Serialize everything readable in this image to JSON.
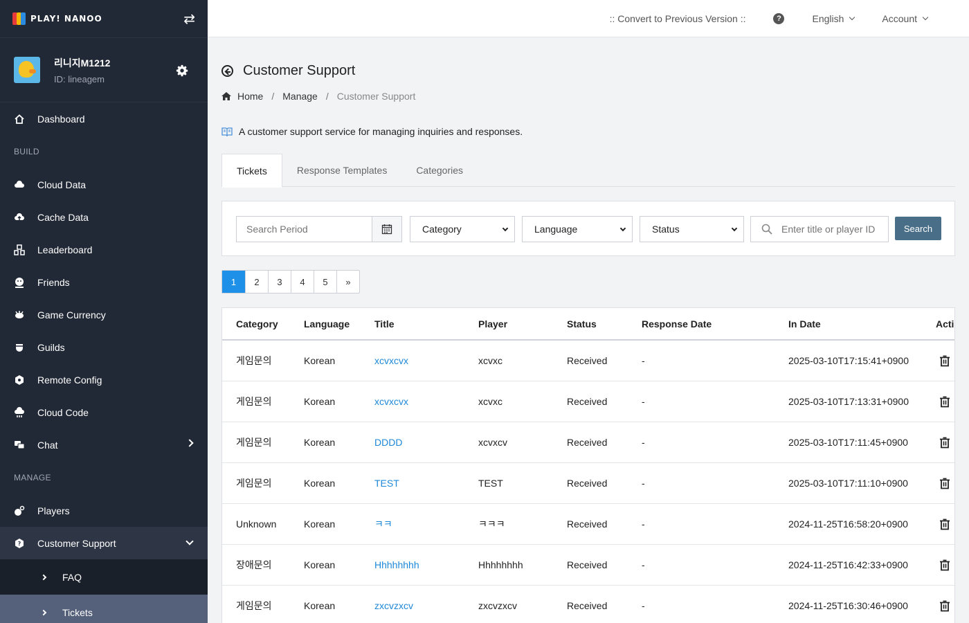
{
  "sidebar": {
    "logo_text": "PLAY! NANOO",
    "profile": {
      "name": "리니지M1212",
      "id": "ID: lineagem"
    },
    "dashboard": "Dashboard",
    "build_section": "BUILD",
    "build_items": [
      {
        "label": "Cloud Data",
        "icon": "cloud-icon"
      },
      {
        "label": "Cache Data",
        "icon": "cloud-upload-icon"
      },
      {
        "label": "Leaderboard",
        "icon": "leaderboard-icon"
      },
      {
        "label": "Friends",
        "icon": "friends-icon"
      },
      {
        "label": "Game Currency",
        "icon": "currency-icon"
      },
      {
        "label": "Guilds",
        "icon": "guilds-icon"
      },
      {
        "label": "Remote Config",
        "icon": "remote-config-icon"
      },
      {
        "label": "Cloud Code",
        "icon": "cloud-code-icon"
      },
      {
        "label": "Chat",
        "icon": "chat-icon"
      }
    ],
    "manage_section": "MANAGE",
    "players": "Players",
    "customer_support": "Customer Support",
    "sub_items": [
      "FAQ",
      "Tickets"
    ]
  },
  "topbar": {
    "convert": ":: Convert to Previous Version ::",
    "help": "?",
    "language": "English",
    "account": "Account"
  },
  "page": {
    "title": "Customer Support",
    "breadcrumb": [
      "Home",
      "Manage",
      "Customer Support"
    ],
    "breadcrumb_sep": "/",
    "description": "A customer support service for managing inquiries and responses."
  },
  "tabs": [
    "Tickets",
    "Response Templates",
    "Categories"
  ],
  "filters": {
    "period_placeholder": "Search Period",
    "category": "Category",
    "language": "Language",
    "status": "Status",
    "search_placeholder": "Enter title or player ID",
    "search_button": "Search"
  },
  "pagination": [
    "1",
    "2",
    "3",
    "4",
    "5",
    "»"
  ],
  "table": {
    "headers": [
      "Category",
      "Language",
      "Title",
      "Player",
      "Status",
      "Response Date",
      "In Date",
      "Action"
    ],
    "rows": [
      [
        "게임문의",
        "Korean",
        "xcvxcvx",
        "xcvxc",
        "Received",
        "-",
        "2025-03-10T17:15:41+0900"
      ],
      [
        "게임문의",
        "Korean",
        "xcvxcvx",
        "xcvxc",
        "Received",
        "-",
        "2025-03-10T17:13:31+0900"
      ],
      [
        "게임문의",
        "Korean",
        "DDDD",
        "xcvxcv",
        "Received",
        "-",
        "2025-03-10T17:11:45+0900"
      ],
      [
        "게임문의",
        "Korean",
        "TEST",
        "TEST",
        "Received",
        "-",
        "2025-03-10T17:11:10+0900"
      ],
      [
        "Unknown",
        "Korean",
        "ㅋㅋ",
        "ㅋㅋㅋ",
        "Received",
        "-",
        "2024-11-25T16:58:20+0900"
      ],
      [
        "장애문의",
        "Korean",
        "Hhhhhhhh",
        "Hhhhhhhh",
        "Received",
        "-",
        "2024-11-25T16:42:33+0900"
      ],
      [
        "게임문의",
        "Korean",
        "zxcvzxcv",
        "zxcvzxcv",
        "Received",
        "-",
        "2024-11-25T16:30:46+0900"
      ]
    ]
  }
}
